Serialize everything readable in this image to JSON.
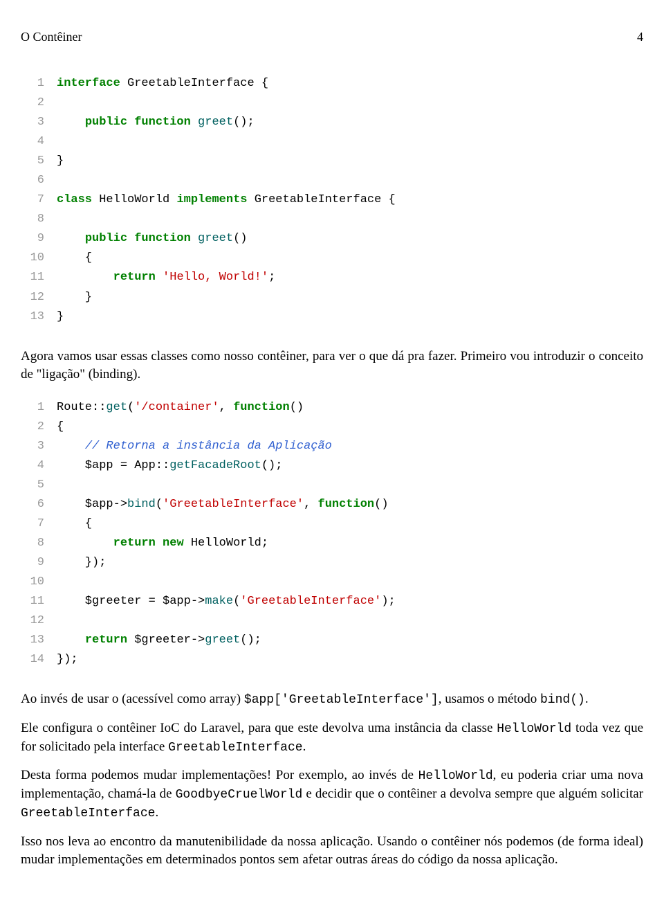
{
  "header": {
    "title": "O Contêiner",
    "page": "4"
  },
  "code1": {
    "lines": [
      {
        "n": "1",
        "html": "<span class='kw'>interface</span> <span class='cls'>GreetableInterface</span> {"
      },
      {
        "n": "2",
        "html": ""
      },
      {
        "n": "3",
        "html": "    <span class='kw'>public function</span> <span class='fn'>greet</span>();"
      },
      {
        "n": "4",
        "html": ""
      },
      {
        "n": "5",
        "html": "}"
      },
      {
        "n": "6",
        "html": ""
      },
      {
        "n": "7",
        "html": "<span class='kw'>class</span> <span class='cls'>HelloWorld</span> <span class='kw'>implements</span> <span class='cls'>GreetableInterface</span> {"
      },
      {
        "n": "8",
        "html": ""
      },
      {
        "n": "9",
        "html": "    <span class='kw'>public function</span> <span class='fn'>greet</span>()"
      },
      {
        "n": "10",
        "html": "    {"
      },
      {
        "n": "11",
        "html": "        <span class='kw'>return</span> <span class='str'>'Hello, World!'</span>;"
      },
      {
        "n": "12",
        "html": "    }"
      },
      {
        "n": "13",
        "html": "}"
      }
    ]
  },
  "para1": "Agora vamos usar essas classes como nosso contêiner, para ver o que dá pra fazer. Primeiro vou introduzir o conceito de \"ligação\" (binding).",
  "code2": {
    "lines": [
      {
        "n": "1",
        "html": "Route::<span class='fn'>get</span>(<span class='str'>'/container'</span>, <span class='kw'>function</span>()"
      },
      {
        "n": "2",
        "html": "{"
      },
      {
        "n": "3",
        "html": "    <span class='cmt'>// Retorna a instância da Aplicação</span>"
      },
      {
        "n": "4",
        "html": "    $app = App::<span class='fn'>getFacadeRoot</span>();"
      },
      {
        "n": "5",
        "html": ""
      },
      {
        "n": "6",
        "html": "    $app-&gt;<span class='fn'>bind</span>(<span class='str'>'GreetableInterface'</span>, <span class='kw'>function</span>()"
      },
      {
        "n": "7",
        "html": "    {"
      },
      {
        "n": "8",
        "html": "        <span class='kw'>return new</span> HelloWorld;"
      },
      {
        "n": "9",
        "html": "    });"
      },
      {
        "n": "10",
        "html": ""
      },
      {
        "n": "11",
        "html": "    $greeter = $app-&gt;<span class='fn'>make</span>(<span class='str'>'GreetableInterface'</span>);"
      },
      {
        "n": "12",
        "html": ""
      },
      {
        "n": "13",
        "html": "    <span class='kw'>return</span> $greeter-&gt;<span class='fn'>greet</span>();"
      },
      {
        "n": "14",
        "html": "});"
      }
    ]
  },
  "para2_pre": "Ao invés de usar o (acessível como array) ",
  "para2_code1": "$app['GreetableInterface']",
  "para2_mid": ", usamos o método ",
  "para2_code2": "bind()",
  "para2_post": ".",
  "para3_pre": "Ele configura o contêiner IoC do Laravel, para que este devolva uma instância da classe ",
  "para3_code1": "HelloWorld",
  "para3_mid": " toda vez que for solicitado pela interface ",
  "para3_code2": "GreetableInterface",
  "para3_post": ".",
  "para4_pre": "Desta forma podemos mudar implementações! Por exemplo, ao invés de ",
  "para4_code1": "HelloWorld",
  "para4_mid1": ", eu poderia criar uma nova implementação, chamá-la de ",
  "para4_code2": "GoodbyeCruelWorld",
  "para4_mid2": " e decidir que o contêiner a devolva sempre que alguém solicitar ",
  "para4_code3": "GreetableInterface",
  "para4_post": ".",
  "para5": "Isso nos leva ao encontro da manutenibilidade da nossa aplicação. Usando o contêiner nós podemos (de forma ideal) mudar implementações em determinados pontos sem afetar outras áreas do código da nossa aplicação."
}
